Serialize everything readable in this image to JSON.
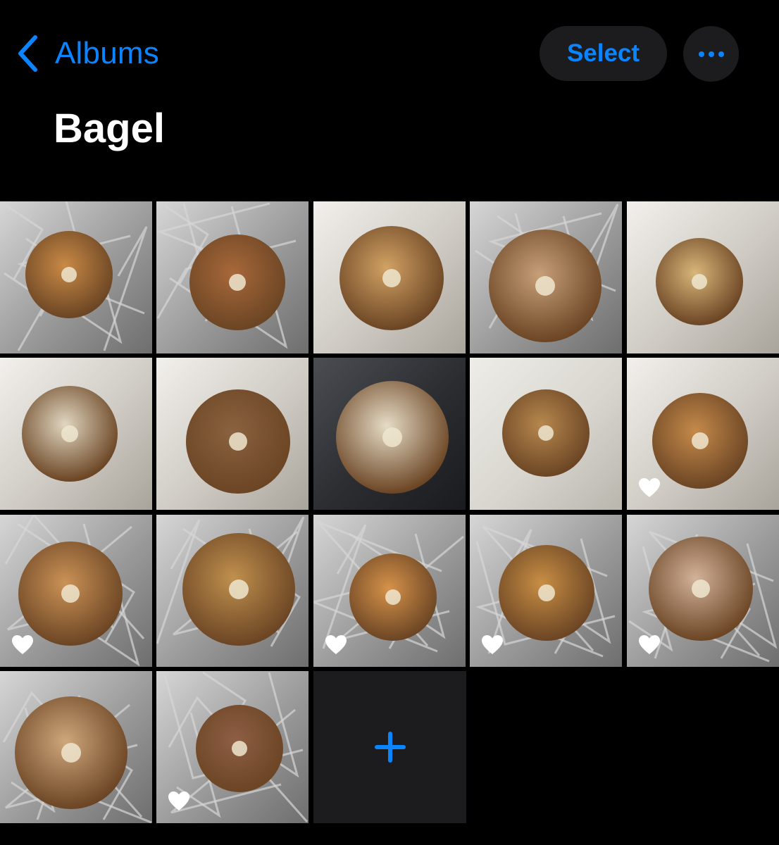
{
  "nav": {
    "back_label": "Albums",
    "select_label": "Select"
  },
  "album": {
    "title": "Bagel"
  },
  "colors": {
    "accent": "#0A84FF",
    "button_bg": "#1C1C1E",
    "background": "#000000"
  },
  "photos": [
    {
      "scene": "foil",
      "bagel": "#C98A46",
      "favorite": false
    },
    {
      "scene": "foil",
      "bagel": "#A8683A",
      "favorite": false
    },
    {
      "scene": "paper",
      "bagel": "#D2A264",
      "favorite": false
    },
    {
      "scene": "foil",
      "bagel": "#C7A07A",
      "favorite": false
    },
    {
      "scene": "paper",
      "bagel": "#D9B67A",
      "favorite": false
    },
    {
      "scene": "paper",
      "bagel": "#E0D6C0",
      "favorite": false
    },
    {
      "scene": "paper",
      "bagel": "#8A6240",
      "favorite": false
    },
    {
      "scene": "car",
      "bagel": "#E6DCC6",
      "favorite": false
    },
    {
      "scene": "table",
      "bagel": "#B7884E",
      "favorite": false
    },
    {
      "scene": "paper",
      "bagel": "#C58A4A",
      "favorite": true
    },
    {
      "scene": "foil",
      "bagel": "#CB9256",
      "favorite": true
    },
    {
      "scene": "foil",
      "bagel": "#C0904E",
      "favorite": false
    },
    {
      "scene": "foil",
      "bagel": "#D6924A",
      "favorite": true
    },
    {
      "scene": "foil",
      "bagel": "#C88E44",
      "favorite": true
    },
    {
      "scene": "foil",
      "bagel": "#D2B29A",
      "favorite": true
    },
    {
      "scene": "foil",
      "bagel": "#CFA77C",
      "favorite": false
    },
    {
      "scene": "foil",
      "bagel": "#8E5E45",
      "favorite": true
    }
  ]
}
